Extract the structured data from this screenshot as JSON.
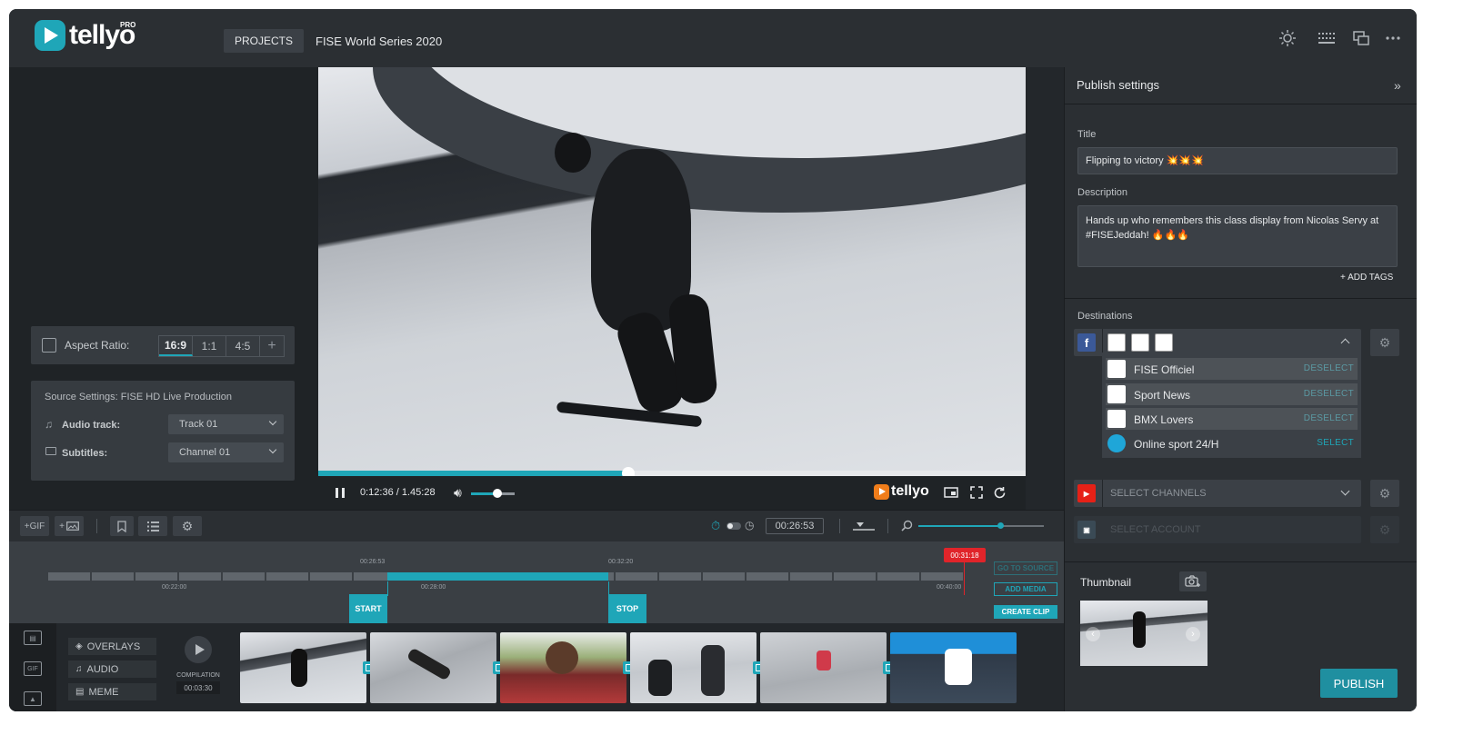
{
  "header": {
    "logo_text": "tellyo",
    "logo_badge": "PRO",
    "projects_label": "PROJECTS",
    "project_name": "FISE World Series 2020",
    "icons": [
      "sun-icon",
      "grid-icon",
      "windows-icon",
      "more-icon"
    ]
  },
  "left_panel": {
    "aspect_label": "Aspect Ratio:",
    "aspect_options": [
      "16:9",
      "1:1",
      "4:5"
    ],
    "aspect_selected": "16:9",
    "aspect_add": "+",
    "source_title": "Source Settings: FISE HD Live Production",
    "audio_label": "Audio track:",
    "audio_value": "Track 01",
    "subtitles_label": "Subtitles:",
    "subtitles_value": "Channel 01"
  },
  "player": {
    "time": "0:12:36 / 1.45:28",
    "progress_fraction": 0.44,
    "volume_fraction": 0.6,
    "watermark": "tellyo"
  },
  "toolbar": {
    "gif_label": "+GIF",
    "image_label": "+",
    "duration": "00:26:53"
  },
  "timeline": {
    "tick_labels": [
      "00:22:00",
      "00:28:00",
      "00:40:00"
    ],
    "start_time": "00:26:53",
    "stop_time": "00:32:20",
    "playhead_time": "00:31:18",
    "start_label": "START",
    "stop_label": "STOP",
    "go_to_source": "GO TO SOURCE",
    "add_media": "ADD MEDIA",
    "create_clip": "CREATE CLIP"
  },
  "clips": {
    "overlays_label": "OVERLAYS",
    "audio_label": "AUDIO",
    "meme_label": "MEME",
    "compilation_label": "COMPILATION",
    "compilation_time": "00:03:30",
    "side_icons": [
      "film-icon",
      "gif-icon",
      "image-icon"
    ]
  },
  "publish": {
    "panel_title": "Publish settings",
    "title_label": "Title",
    "title_value": "Flipping to victory 💥💥💥",
    "description_label": "Description",
    "description_value": "Hands up who remembers this class display from Nicolas Servy at #FISEJeddah! 🔥🔥🔥",
    "add_tags": "+ ADD TAGS",
    "destinations_label": "Destinations",
    "facebook_channels": [
      {
        "name": "FISE Officiel",
        "action": "DESELECT",
        "selected": true
      },
      {
        "name": "Sport News",
        "action": "DESELECT",
        "selected": true
      },
      {
        "name": "BMX Lovers",
        "action": "DESELECT",
        "selected": true
      },
      {
        "name": "Online sport 24/H",
        "action": "SELECT",
        "selected": false
      }
    ],
    "youtube_placeholder": "SELECT CHANNELS",
    "third_placeholder": "SELECT ACCOUNT",
    "thumbnail_label": "Thumbnail",
    "publish_button": "PUBLISH"
  },
  "colors": {
    "accent": "#1fa6b8",
    "facebook": "#3b5998",
    "youtube": "#e62117",
    "playhead": "#e0242a"
  }
}
